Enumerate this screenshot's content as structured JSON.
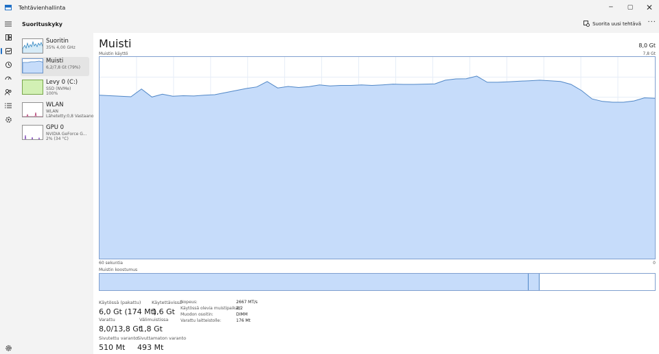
{
  "window": {
    "title": "Tehtävienhallinta"
  },
  "header": {
    "title": "Suorituskyky",
    "run_task": "Suorita uusi tehtävä",
    "more": "···"
  },
  "sidebar": {
    "items": [
      {
        "name": "Suoritin",
        "lines": [
          "35% 4,00 GHz"
        ]
      },
      {
        "name": "Muisti",
        "lines": [
          "6,2/7,8 Gt (79%)"
        ]
      },
      {
        "name": "Levy 0 (C:)",
        "lines": [
          "SSD (NVMe)",
          "100%"
        ]
      },
      {
        "name": "WLAN",
        "lines": [
          "WLAN",
          "Lähetetty:0,8 Vastaanot"
        ]
      },
      {
        "name": "GPU 0",
        "lines": [
          "NVIDIA GeForce G...",
          "2% (34 °C)"
        ]
      }
    ]
  },
  "main": {
    "title": "Muisti",
    "total": "8,0 Gt",
    "usage_label": "Muistin käyttö",
    "usage_max": "7,8 Gt",
    "time_left": "60 sekuntia",
    "time_right": "0",
    "composition_label": "Muistin koostumus",
    "composition": {
      "in_use": 0.772,
      "modified": 0.02
    },
    "stats": {
      "in_use_label": "Käytössä (pakattu)",
      "in_use_value": "6,0 Gt (174 Mt)",
      "available_label": "Käytettävissä",
      "available_value": "1,6 Gt",
      "committed_label": "Varattu",
      "committed_value": "8,0/13,8 Gt",
      "cached_label": "Välimuistissa",
      "cached_value": "1,8 Gt",
      "paged_label": "Sivutettu varanto",
      "paged_value": "510 Mt",
      "nonpaged_label": "Sivuttamaton varanto",
      "nonpaged_value": "493 Mt"
    },
    "details": [
      {
        "key": "Nopeus:",
        "value": "2667 MT/s"
      },
      {
        "key": "Käytössä olevia muistipaikat:",
        "value": "2/2"
      },
      {
        "key": "Muodon osoitin:",
        "value": "DIMM"
      },
      {
        "key": "Varattu laitteistolle:",
        "value": "176 Mt"
      }
    ]
  },
  "chart_data": {
    "type": "area",
    "y_max": 7.8,
    "y_unit": "Gt",
    "x_range": [
      60,
      0
    ],
    "values": [
      6.32,
      6.3,
      6.28,
      6.26,
      6.56,
      6.25,
      6.36,
      6.28,
      6.3,
      6.29,
      6.32,
      6.34,
      6.42,
      6.5,
      6.58,
      6.64,
      6.85,
      6.6,
      6.66,
      6.62,
      6.65,
      6.72,
      6.68,
      6.7,
      6.7,
      6.72,
      6.7,
      6.72,
      6.75,
      6.74,
      6.74,
      6.75,
      6.76,
      6.9,
      6.95,
      6.96,
      7.06,
      6.82,
      6.82,
      6.84,
      6.86,
      6.88,
      6.9,
      6.88,
      6.85,
      6.74,
      6.5,
      6.18,
      6.08,
      6.05,
      6.05,
      6.1,
      6.22,
      6.2
    ],
    "colors": {
      "line": "#4f86c6",
      "fill": "#c6dcfa",
      "grid": "#e6edf7"
    }
  }
}
